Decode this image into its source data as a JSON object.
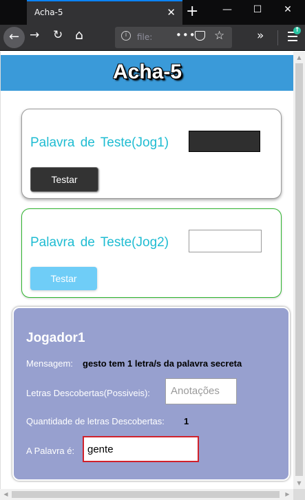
{
  "browser": {
    "tab_title": "Acha-5",
    "url": "file:",
    "tab_close": "✕",
    "new_tab": "+",
    "win_min": "—",
    "win_max": "☐",
    "win_close": "✕",
    "back": "←",
    "forward": "→",
    "reload": "↻",
    "home": "⌂",
    "url_info": "i",
    "url_more": "•••",
    "url_star": "☆",
    "overflow": "»",
    "update_badge": "↑"
  },
  "page": {
    "title": "Acha-5",
    "header_color": "#3a9ad9",
    "player1_test": {
      "label": "Palavra de Teste(Jog1)",
      "input_value": "",
      "button": "Testar"
    },
    "player2_test": {
      "label": "Palavra de Teste(Jog2)",
      "input_value": "",
      "button": "Testar"
    },
    "player_panel": {
      "title": "Jogador1",
      "message_label": "Mensagem:",
      "message_value": "gesto tem 1 letra/s da palavra secreta",
      "letters_label": "Letras Descobertas(Possiveis):",
      "notes_placeholder": "Anotações",
      "count_label": "Quantidade de letras Descobertas:",
      "count_value": "1",
      "word_label": "A Palavra é:",
      "word_value": "gente"
    }
  },
  "scrollbars": {
    "up": "▲",
    "down": "▼",
    "left": "◀",
    "right": "▶"
  }
}
